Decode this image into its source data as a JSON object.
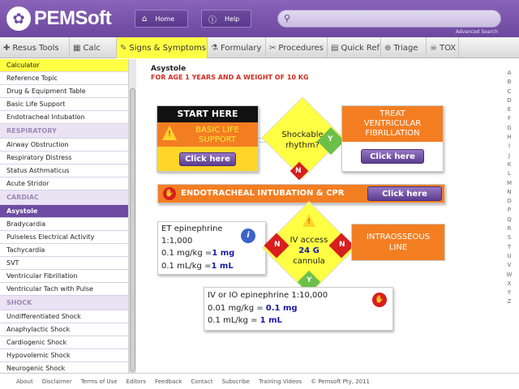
{
  "header": {
    "logo_text": "PEMSoft",
    "home_label": "Home",
    "help_label": "Help",
    "search_placeholder": "",
    "advanced_search": "Advanced Search"
  },
  "nav": [
    {
      "icon": "✚",
      "label": "Resus Tools"
    },
    {
      "icon": "▦",
      "label": "Calc"
    },
    {
      "icon": "✎",
      "label": "Signs & Symptoms"
    },
    {
      "icon": "⚗",
      "label": "Formulary"
    },
    {
      "icon": "✂",
      "label": "Procedures"
    },
    {
      "icon": "▤",
      "label": "Quick Ref"
    },
    {
      "icon": "⊕",
      "label": "Triage"
    },
    {
      "icon": "☠",
      "label": "TOX"
    }
  ],
  "sidebar": {
    "items_top": [
      "Calculator",
      "Reference Topic",
      "Drug & Equipment Table",
      "Basic Life Support",
      "Endotracheal Intubation"
    ],
    "respiratory_header": "RESPIRATORY",
    "respiratory": [
      "Airway Obstruction",
      "Respiratory Distress",
      "Status Asthmaticus",
      "Acute Stridor"
    ],
    "cardiac_header": "CARDIAC",
    "cardiac": [
      "Asystole",
      "Bradycardia",
      "Pulseless Electrical Activity",
      "Tachycardia",
      "SVT",
      "Ventricular Fibrillation",
      "Ventricular Tach with Pulse"
    ],
    "shock_header": "SHOCK",
    "shock": [
      "Undifferentiated Shock",
      "Anaphylactic Shock",
      "Cardiogenic Shock",
      "Hypovolemic Shock",
      "Neurogenic Shock"
    ]
  },
  "main": {
    "title": "Asystole",
    "subtitle": "FOR AGE 1 YEARS AND A WEIGHT OF 10 KG",
    "start_here": "START HERE",
    "bls_line1": "BASIC LIFE",
    "bls_line2": "SUPPORT",
    "click_here": "Click here",
    "shockable_line1": "Shockable",
    "shockable_line2": "rhythm?",
    "yes": "Y",
    "no": "N",
    "treat_line1": "TREAT",
    "treat_line2": "VENTRICULAR",
    "treat_line3": "FIBRILLATION",
    "eti_label": "ENDOTRACHEAL INTUBATION & CPR",
    "et_title": "ET epinephrine",
    "et_ratio": "1:1,000",
    "et_dose_label": "0.1 mg/kg =",
    "et_dose_value": "1 mg",
    "et_vol_label": "0.1 mL/kg =",
    "et_vol_value": "1 mL",
    "iv_line1": "IV access",
    "iv_line2": "24 G",
    "iv_line3": "cannula",
    "io_line1": "INTRAOSSEOUS",
    "io_line2": "LINE",
    "ivio_title": "IV or IO epinephrine 1:10,000",
    "ivio_dose_label": "0.01 mg/kg =",
    "ivio_dose_value": "0.1 mg",
    "ivio_vol_label": "0.1 mL/kg  =",
    "ivio_vol_value": "1 mL"
  },
  "alphabet": [
    "A",
    "B",
    "C",
    "D",
    "E",
    "F",
    "G",
    "H",
    "I",
    "J",
    "K",
    "L",
    "M",
    "N",
    "O",
    "P",
    "Q",
    "R",
    "S",
    "T",
    "U",
    "V",
    "W",
    "X",
    "Y",
    "Z"
  ],
  "footer": [
    "About",
    "Disclaimer",
    "Terms of Use",
    "Editors",
    "Feedback",
    "Contact",
    "Subscribe",
    "Training Videos",
    "© Pemsoft Pty, 2011"
  ],
  "colors": {
    "purple": "#6f4ca3",
    "orange": "#f37e22",
    "yellow": "#ffff44",
    "red": "#d81e1e"
  }
}
